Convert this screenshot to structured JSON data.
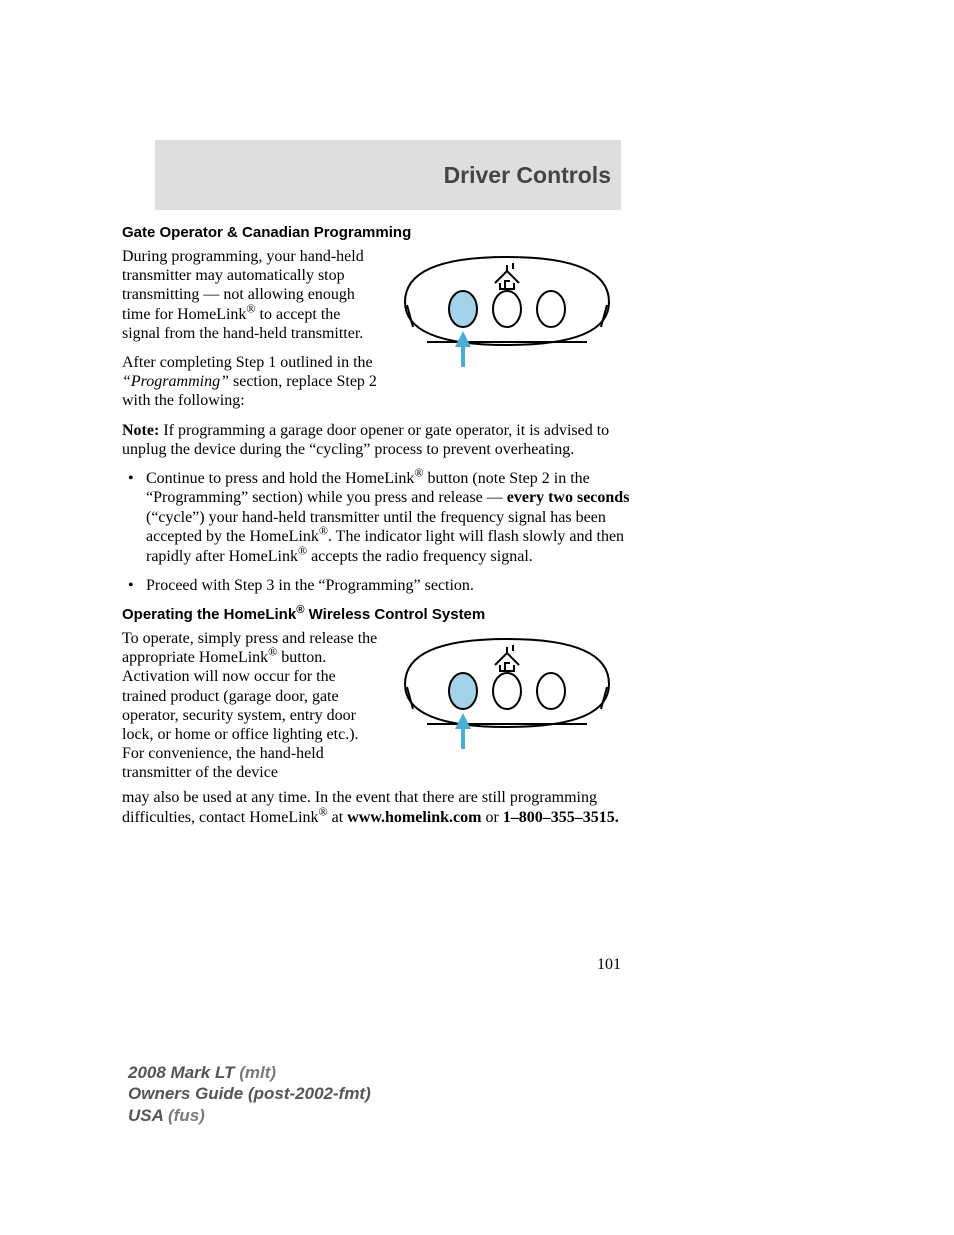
{
  "header": {
    "title": "Driver Controls"
  },
  "section1": {
    "heading": "Gate Operator & Canadian Programming",
    "para1_pre": "During programming, your hand-held transmitter may automatically stop transmitting — not allowing enough time for HomeLink",
    "para1_post": " to accept the signal from the hand-held transmitter.",
    "para2_pre": "After completing Step 1 outlined in the ",
    "para2_ital": "“Programming”",
    "para2_post": " section, replace Step 2 with the following:",
    "note_label": "Note:",
    "note_body": " If programming a garage door opener or gate operator, it is advised to unplug the device during the “cycling” process to prevent overheating.",
    "bullet1_a": "Continue to press and hold the HomeLink",
    "bullet1_b": " button (note Step 2 in the “Programming” section) while you press and release — ",
    "bullet1_bold": "every two seconds",
    "bullet1_c": " (“cycle”) your hand-held transmitter until the frequency signal has been accepted by the HomeLink",
    "bullet1_d": ". The indicator light will flash slowly and then rapidly after HomeLink",
    "bullet1_e": " accepts the radio frequency signal.",
    "bullet2": "Proceed with Step 3 in the “Programming” section."
  },
  "section2": {
    "heading_a": "Operating the HomeLink",
    "heading_b": " Wireless Control System",
    "para_a": "To operate, simply press and release the appropriate HomeLink",
    "para_b": " button. Activation will now occur for the trained product (garage door, gate operator, security system, entry door lock, or home or office lighting etc.). For convenience, the hand-held transmitter of the device",
    "para_c_pre": "may also be used at any time. In the event that there are still programming difficulties, contact HomeLink",
    "para_c_mid": " at ",
    "para_c_link": "www.homelink.com",
    "para_c_or": " or ",
    "para_c_phone": "1–800–355–3515."
  },
  "reg": "®",
  "page_number": "101",
  "footer": {
    "l1a": "2008 Mark LT ",
    "l1b": "(mlt)",
    "l2": "Owners Guide (post-2002-fmt)",
    "l3a": "USA ",
    "l3b": "(fus)"
  }
}
